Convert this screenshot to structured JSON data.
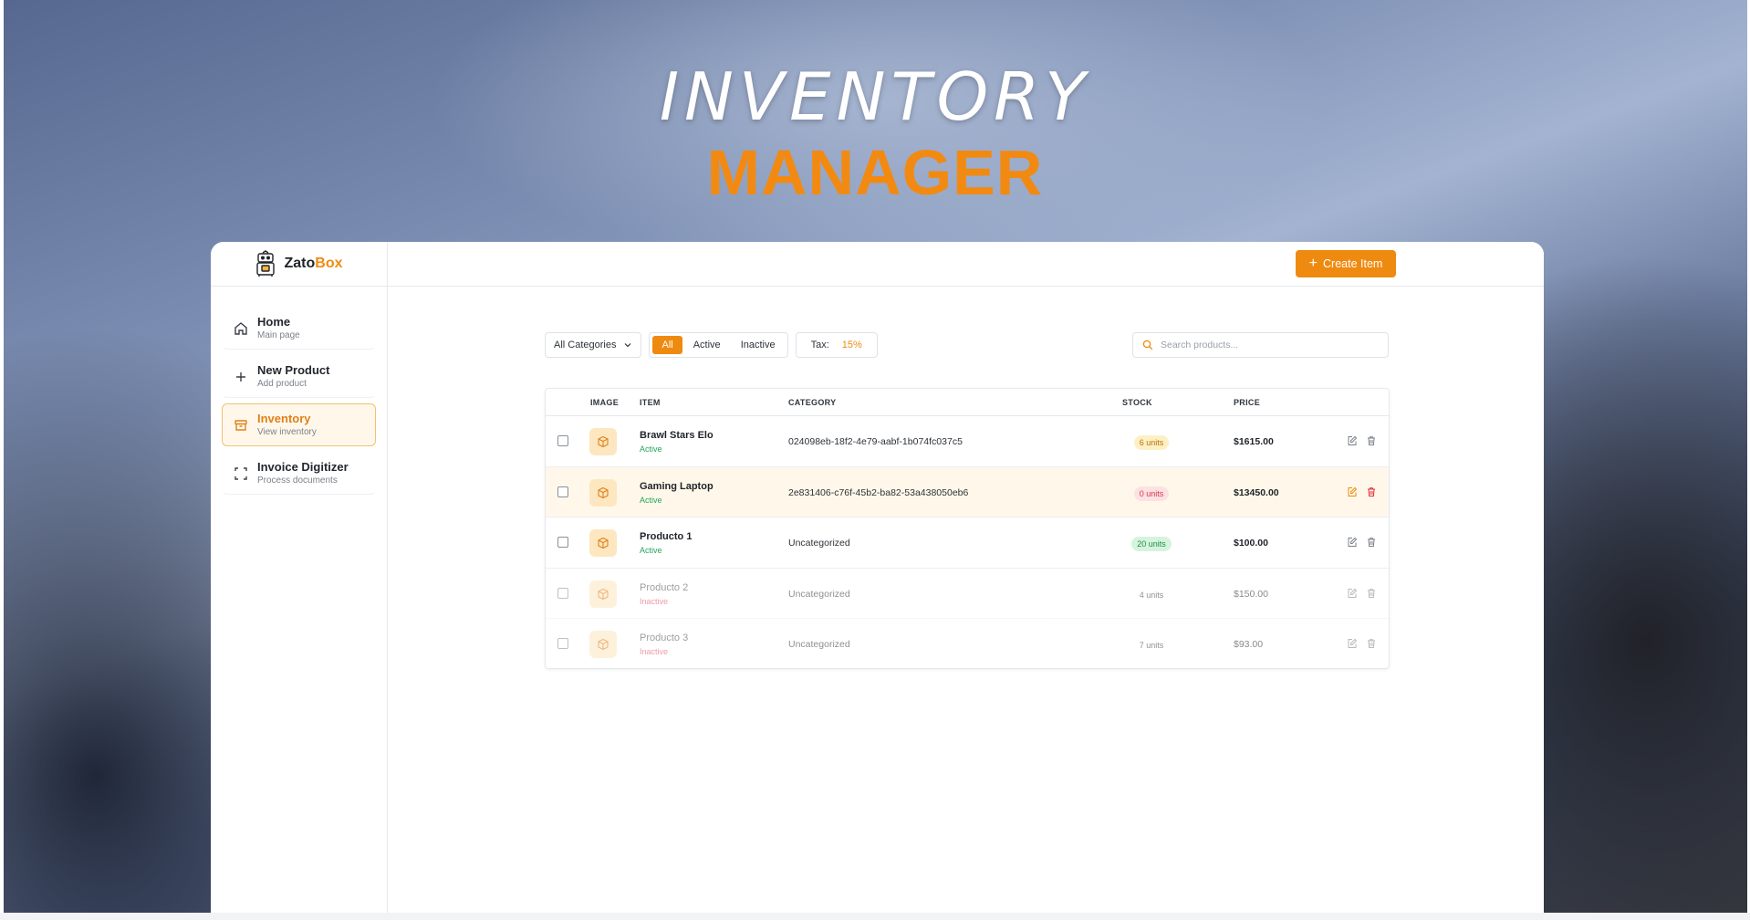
{
  "hero": {
    "line1": "INVENTORY",
    "line2": "MANAGER"
  },
  "brand": {
    "name_part1": "Zato",
    "name_part2": "Box"
  },
  "sidebar": {
    "items": [
      {
        "title": "Home",
        "subtitle": "Main page",
        "icon": "home-icon"
      },
      {
        "title": "New Product",
        "subtitle": "Add product",
        "icon": "plus-icon"
      },
      {
        "title": "Inventory",
        "subtitle": "View inventory",
        "icon": "archive-icon",
        "active": true
      },
      {
        "title": "Invoice Digitizer",
        "subtitle": "Process documents",
        "icon": "scan-icon"
      }
    ]
  },
  "topbar": {
    "create_label": "Create Item"
  },
  "filters": {
    "category_value": "All Categories",
    "segments": [
      "All",
      "Active",
      "Inactive"
    ],
    "selected_segment": "All",
    "tax_label": "Tax:",
    "tax_value": "15%"
  },
  "search": {
    "placeholder": "Search products..."
  },
  "table": {
    "columns": [
      "IMAGE",
      "ITEM",
      "CATEGORY",
      "STOCK",
      "PRICE"
    ],
    "rows": [
      {
        "name": "Brawl Stars Elo",
        "status": "Active",
        "category": "024098eb-18f2-4e79-aabf-1b074fc037c5",
        "stock": "6 units",
        "price": "$1615.00"
      },
      {
        "name": "Gaming Laptop",
        "status": "Active",
        "category": "2e831406-c76f-45b2-ba82-53a438050eb6",
        "stock": "0 units",
        "price": "$13450.00"
      },
      {
        "name": "Producto 1",
        "status": "Active",
        "category": "Uncategorized",
        "stock": "20 units",
        "price": "$100.00"
      },
      {
        "name": "Producto 2",
        "status": "Inactive",
        "category": "Uncategorized",
        "stock": "4 units",
        "price": "$150.00"
      },
      {
        "name": "Producto 3",
        "status": "Inactive",
        "category": "Uncategorized",
        "stock": "7 units",
        "price": "$93.00"
      }
    ]
  },
  "colors": {
    "accent": "#ef8a10",
    "active": "#22a55b",
    "inactive": "#e0475c",
    "danger": "#e0303f"
  }
}
